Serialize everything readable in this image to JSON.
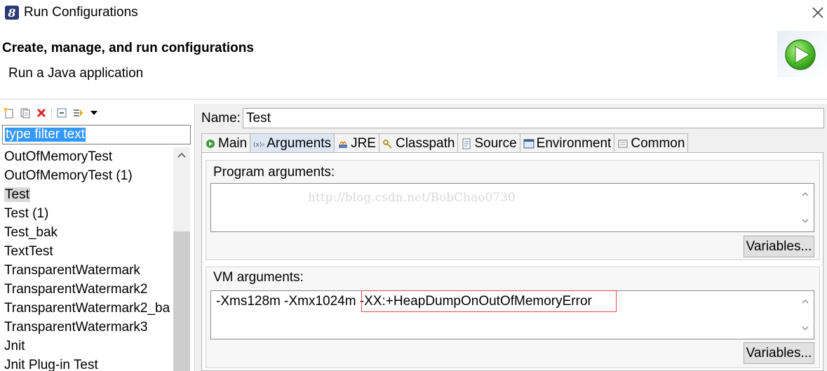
{
  "window": {
    "title": "Run Configurations",
    "icon": "eclipse-logo-icon",
    "close_icon": "close-icon"
  },
  "header": {
    "title": "Create, manage, and run configurations",
    "subtitle": "Run a Java application",
    "icon": "run-play-icon",
    "icon_color": "#3fae2a"
  },
  "left": {
    "toolbar": [
      "new-config-icon",
      "duplicate-icon",
      "delete-icon",
      "collapse-all-icon",
      "filter-icon",
      "dropdown-arrow-icon"
    ],
    "filter_text": "type filter text",
    "items": [
      {
        "label": "OutOfMemoryTest",
        "selected": false
      },
      {
        "label": "OutOfMemoryTest (1)",
        "selected": false
      },
      {
        "label": "Test",
        "selected": true
      },
      {
        "label": "Test (1)",
        "selected": false
      },
      {
        "label": "Test_bak",
        "selected": false
      },
      {
        "label": "TextTest",
        "selected": false
      },
      {
        "label": "TransparentWatermark",
        "selected": false
      },
      {
        "label": "TransparentWatermark2",
        "selected": false
      },
      {
        "label": "TransparentWatermark2_ba",
        "selected": false
      },
      {
        "label": "TransparentWatermark3",
        "selected": false
      },
      {
        "label": "Jnit",
        "selected": false
      },
      {
        "label": "Jnit Plug-in Test",
        "selected": false
      }
    ]
  },
  "right": {
    "name_label": "Name:",
    "name_value": "Test",
    "tabs": [
      {
        "label": "Main",
        "icon": "main-tab-icon",
        "active": false
      },
      {
        "label": "Arguments",
        "icon": "arguments-tab-icon",
        "active": true
      },
      {
        "label": "JRE",
        "icon": "jre-tab-icon",
        "active": false
      },
      {
        "label": "Classpath",
        "icon": "classpath-tab-icon",
        "active": false
      },
      {
        "label": "Source",
        "icon": "source-tab-icon",
        "active": false
      },
      {
        "label": "Environment",
        "icon": "environment-tab-icon",
        "active": false
      },
      {
        "label": "Common",
        "icon": "common-tab-icon",
        "active": false
      }
    ],
    "program_args": {
      "label": "Program arguments:",
      "value": "",
      "watermark": "http://blog.csdn.net/BobChao0730",
      "variables_label": "Variables..."
    },
    "vm_args": {
      "label": "VM arguments:",
      "value_part1": "-Xms128m -Xmx1024m ",
      "value_part2": "-XX:+HeapDumpOnOutOfMemoryError",
      "highlight_color": "#e84b4b",
      "variables_label": "Variables..."
    }
  }
}
